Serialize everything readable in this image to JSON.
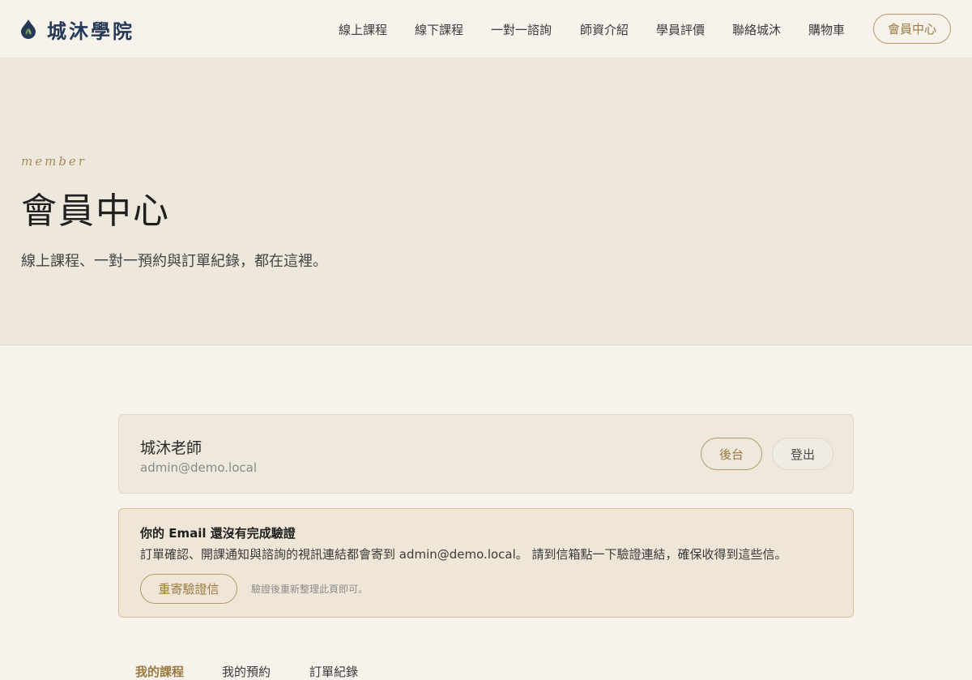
{
  "brand": {
    "name": "城沐學院",
    "logo_icon": "leaf-drop-icon",
    "colors": {
      "primary": "#243957",
      "leaf": "#6e8f4e"
    }
  },
  "nav": {
    "items": [
      {
        "label": "線上課程"
      },
      {
        "label": "線下課程"
      },
      {
        "label": "一對一諮詢"
      },
      {
        "label": "師資介紹"
      },
      {
        "label": "學員評價"
      },
      {
        "label": "聯絡城沐"
      },
      {
        "label": "購物車"
      }
    ],
    "member_button": "會員中心"
  },
  "hero": {
    "kicker": "member",
    "title": "會員中心",
    "description": "線上課程、一對一預約與訂單紀錄，都在這裡。"
  },
  "profile": {
    "name": "城沐老師",
    "email": "admin@demo.local",
    "admin_button": "後台",
    "logout_button": "登出"
  },
  "notice": {
    "title": "你的 Email 還沒有完成驗證",
    "body": "訂單確認、開課通知與諮詢的視訊連結都會寄到 admin@demo.local。 請到信箱點一下驗證連結，確保收得到這些信。",
    "resend_button": "重寄驗證信",
    "hint": "驗證後重新整理此頁即可。"
  },
  "tabs": [
    {
      "label": "我的課程",
      "active": true
    },
    {
      "label": "我的預約",
      "active": false
    },
    {
      "label": "訂單紀錄",
      "active": false
    }
  ],
  "theme": {
    "accent": "#9a7a3f",
    "accent_border": "#b49a6a",
    "background": "#f7f3ec",
    "hero_background": "#ede7dc"
  }
}
